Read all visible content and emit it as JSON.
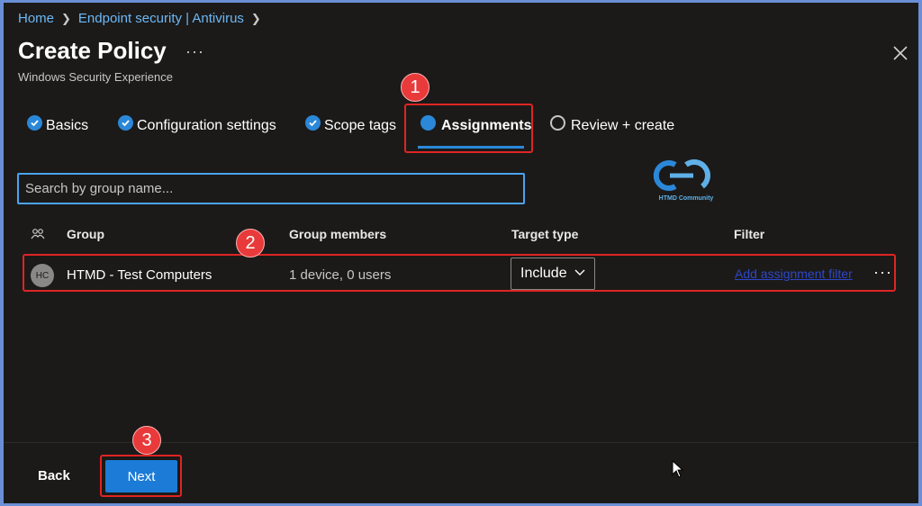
{
  "breadcrumb": {
    "home": "Home",
    "section": "Endpoint security | Antivirus"
  },
  "header": {
    "title": "Create Policy",
    "more": "···",
    "subtitle": "Windows Security Experience"
  },
  "steps": [
    {
      "label": "Basics",
      "state": "done"
    },
    {
      "label": "Configuration settings",
      "state": "done"
    },
    {
      "label": "Scope tags",
      "state": "done"
    },
    {
      "label": "Assignments",
      "state": "active"
    },
    {
      "label": "Review + create",
      "state": "pending"
    }
  ],
  "search": {
    "placeholder": "Search by group name...",
    "value": ""
  },
  "logo": {
    "caption": "HTMD Community",
    "colors": {
      "primary": "#2b88d8",
      "secondary": "#5fb0e8"
    }
  },
  "table": {
    "headers": {
      "group": "Group",
      "members": "Group members",
      "target": "Target type",
      "filter": "Filter"
    },
    "rows": [
      {
        "avatar": "HC",
        "group": "HTMD - Test Computers",
        "members": "1 device, 0 users",
        "target": "Include",
        "filter_link": "Add assignment filter",
        "more": "···"
      }
    ]
  },
  "footer": {
    "back_label": "Back",
    "next_label": "Next"
  },
  "annotations": [
    "1",
    "2",
    "3"
  ],
  "colors": {
    "accent": "#2b88d8",
    "highlight": "#e02424",
    "badge": "#e83a3a",
    "background": "#1b1a19"
  }
}
